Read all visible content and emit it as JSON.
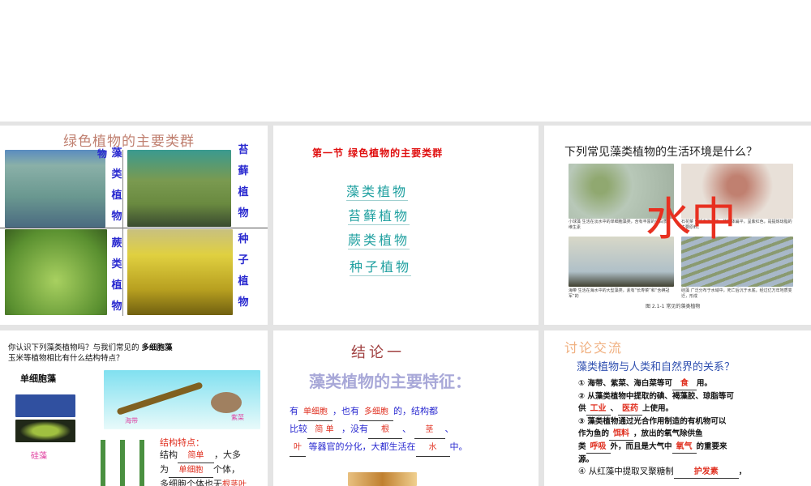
{
  "slides": [
    {
      "title": "绿色植物的主要类群",
      "labels": {
        "algae": "藻类植物",
        "moss": "苔藓植物",
        "fern": "蕨类植物",
        "seed": "种子植物"
      }
    },
    {
      "title": "第一节  绿色植物的主要类群",
      "items": [
        "藻类植物",
        "苔藓植物",
        "蕨类植物",
        "种子植物"
      ]
    },
    {
      "title": "下列常见藻类植物的生活环境是什么？",
      "overlay": "水中",
      "captions": [
        "小球藻  生活在淡水中的单细胞藻类，含有丰富的蛋白质、维生素",
        "石花菜  生活在海洋中，植物体扁平，呈紫红色，是提炼琼脂的主要原料。",
        "海带  生活在海水中的大型藻类，素有“长寿菜”和“含碘冠军”的",
        "硅藻  广泛分布于水域中，死亡后沉于水底，经过亿万年地质变迁，形成"
      ],
      "figure": "图 2.1-1   常见的藻类植物"
    },
    {
      "question_line1": "你认识下列藻类植物吗？与我们常见的",
      "question_tag": "多细胞藻",
      "question_line2": "玉米等植物相比有什么结构特点？",
      "unicell": "单细胞藻",
      "diatom": "硅藻",
      "kelp": "海带",
      "laver": "紫菜",
      "feature_title": "结构特点：",
      "f1a": "结构",
      "f1b": "简单",
      "f1c": "，大多",
      "f2a": "为",
      "f2b": "单细胞",
      "f2c": "个体，",
      "f3a": "多细胞个体也无",
      "f3b": "根茎叶"
    },
    {
      "title": "结论一",
      "subtitle": "藻类植物的主要特征：",
      "t1": "有",
      "b1": "单细胞",
      "t2": "，也有",
      "b2": "多细胞",
      "t3": "的，结构都",
      "t4": "比较",
      "b3": "简 单",
      "t5": "，没有",
      "b4": "根",
      "t6": "、",
      "b5": "茎",
      "t7": "、",
      "b6": "叶",
      "t8": "等器官的分化，大都生活在",
      "b7": "水",
      "t9": "中。"
    },
    {
      "title": "讨论交流",
      "subtitle": "藻类植物与人类和自然界的关系？",
      "p1a": "① 海带、紫菜、海白菜等可",
      "p1b": "食",
      "p1c": "用。",
      "p2a": "② 从藻类植物中提取的碘、褐藻胶、琼脂等可",
      "p2b": "供",
      "p2c": "工业",
      "p2d": "、",
      "p2e": "医药",
      "p2f": "上使用。",
      "p3a": "③ 藻类植物通过光合作用制造的有机物可以",
      "p3b": "作为鱼的",
      "p3c": "饵料",
      "p3d": "，放出的氧气除供鱼",
      "p3e": "类",
      "p3f": "呼吸",
      "p3g": "外，而且是大气中",
      "p3h": "氧气",
      "p3i": "的重要来",
      "p3j": "源。",
      "p4a": "④ 从红藻中提取叉聚糖制",
      "p4b": "护发素",
      "p4c": "，"
    }
  ]
}
